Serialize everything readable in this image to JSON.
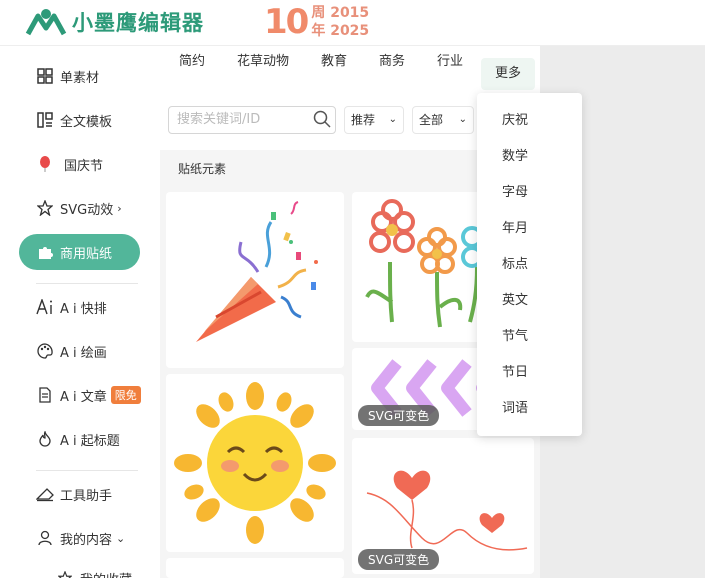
{
  "header": {
    "logo_text": "小墨鹰编辑器",
    "anniv_number": "10",
    "anniv_line1": "周 2015",
    "anniv_line2": "年 2025"
  },
  "sidebar": {
    "items": [
      {
        "label": "单素材",
        "icon": "grid-icon"
      },
      {
        "label": "全文模板",
        "icon": "template-icon"
      },
      {
        "label": "国庆节",
        "icon": "balloon-icon"
      },
      {
        "label": "SVG动效",
        "icon": "star-icon"
      },
      {
        "label": "商用贴纸",
        "icon": "puzzle-icon"
      },
      {
        "label": "A i 快排",
        "icon": "ai-icon"
      },
      {
        "label": "A i 绘画",
        "icon": "palette-icon"
      },
      {
        "label": "A i 文章",
        "icon": "doc-icon",
        "badge": "限免"
      },
      {
        "label": "A i 起标题",
        "icon": "flame-icon"
      },
      {
        "label": "工具助手",
        "icon": "ruler-icon"
      },
      {
        "label": "我的内容",
        "icon": "user-icon"
      },
      {
        "label": "我的收藏",
        "icon": "star-icon"
      }
    ],
    "active_color": "#52b69a"
  },
  "tabs": [
    "简约",
    "花草动物",
    "教育",
    "商务",
    "行业",
    "更多"
  ],
  "search": {
    "placeholder": "搜索关键词/ID"
  },
  "filters": {
    "sort": "推荐",
    "scope": "全部"
  },
  "section_label": "贴纸元素",
  "cards": {
    "svg_tag": "SVG可变色"
  },
  "more_menu": [
    "庆祝",
    "数学",
    "字母",
    "年月",
    "标点",
    "英文",
    "节气",
    "节日",
    "词语"
  ],
  "colors": {
    "brand": "#2d9a79",
    "anniv": "#f08a6a",
    "badge": "#f07e3c"
  }
}
